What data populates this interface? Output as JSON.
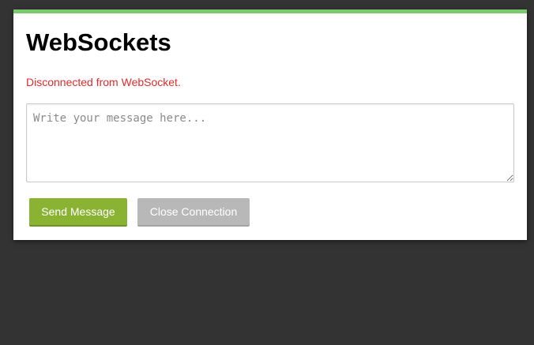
{
  "page": {
    "title": "WebSockets",
    "status_text": "Disconnected from WebSocket.",
    "status_color": "#e32b2b",
    "accent_color": "#7ac96e"
  },
  "message": {
    "placeholder": "Write your message here...",
    "value": ""
  },
  "actions": {
    "send_label": "Send Message",
    "close_label": "Close Connection"
  }
}
